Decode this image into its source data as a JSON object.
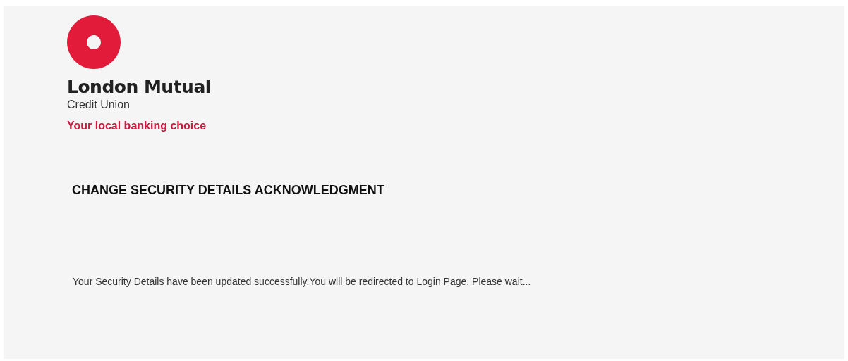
{
  "brand": {
    "name": "London Mutual",
    "subtitle": "Credit Union",
    "tagline": "Your local banking choice"
  },
  "heading": "CHANGE SECURITY DETAILS ACKNOWLEDGMENT",
  "message": "Your Security Details have been updated successfully.You will be redirected to Login Page. Please wait..."
}
